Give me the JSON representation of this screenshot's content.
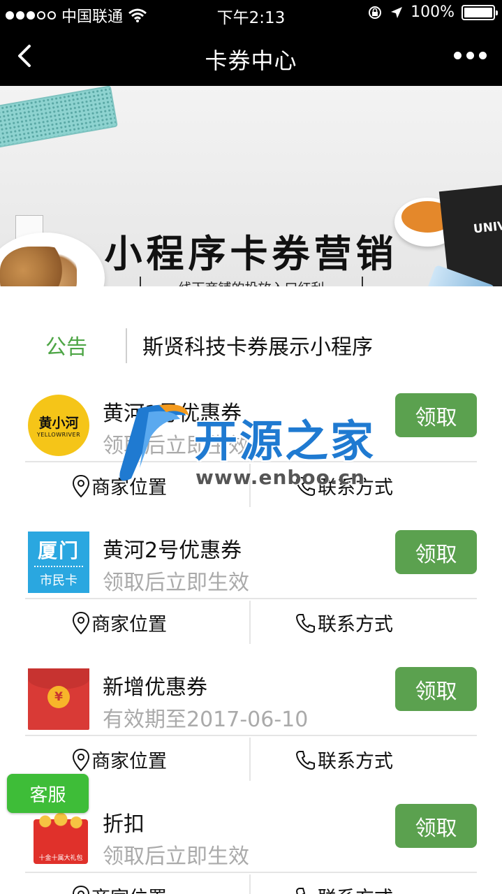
{
  "status_bar": {
    "carrier": "中国联通",
    "time": "下午2:13",
    "battery": "100%"
  },
  "nav": {
    "title": "卡券中心",
    "back_icon": "chevron-left-icon",
    "more_icon": "more-dots-icon"
  },
  "banner": {
    "title": "小程序卡券营销",
    "subtitle": "线下商铺的投放入口红利",
    "clapper_text": "UNIV",
    "active_index": 0,
    "count": 2
  },
  "notice": {
    "label": "公告",
    "text": "斯贤科技卡券展示小程序"
  },
  "coupons": [
    {
      "title": "黄河1号优惠券",
      "desc": "领取后立即生效",
      "button": "领取",
      "location": "商家位置",
      "contact": "联系方式",
      "logo_text": "黄小河",
      "logo_sub": "YELLOWRIVER"
    },
    {
      "title": "黄河2号优惠券",
      "desc": "领取后立即生效",
      "button": "领取",
      "location": "商家位置",
      "contact": "联系方式",
      "logo_text": "厦门",
      "logo_sub": "市民卡"
    },
    {
      "title": "新增优惠券",
      "desc": "有效期至2017-06-10",
      "button": "领取",
      "location": "商家位置",
      "contact": "联系方式",
      "logo_text": "¥"
    },
    {
      "title": "折扣",
      "desc": "领取后立即生效",
      "button": "领取",
      "location": "商家位置",
      "contact": "联系方式",
      "logo_text": "十金十属大礼包"
    }
  ],
  "service_button": "客服",
  "watermark": {
    "text": "开源之家",
    "url": "www.enboo.cn"
  },
  "colors": {
    "accent_green": "#5ba14f",
    "notice_green": "#4da545",
    "service_green": "#3ebd38",
    "nav_bg": "#000000"
  }
}
